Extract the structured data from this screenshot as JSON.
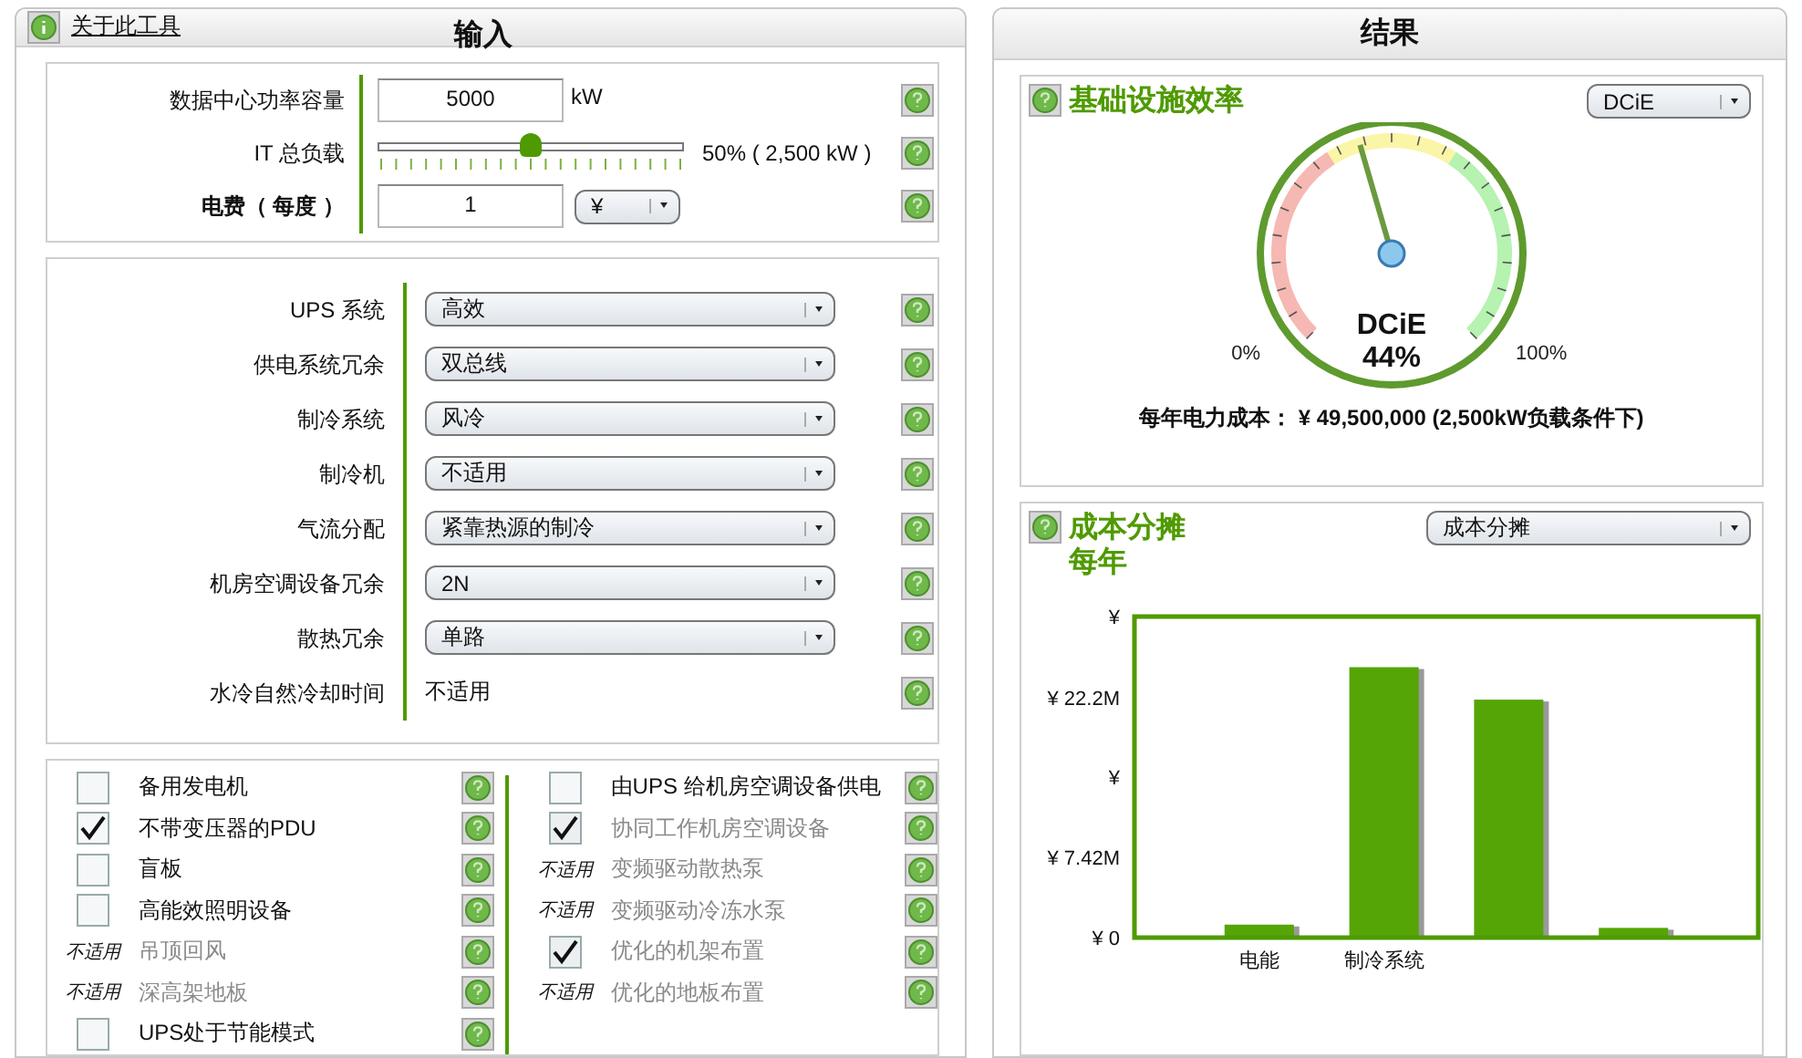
{
  "input_panel": {
    "title": "输入",
    "about_link": "关于此工具",
    "basics": {
      "capacity": {
        "label": "数据中心功率容量",
        "value": "5000",
        "unit": "kW"
      },
      "it_load": {
        "label": "IT 总负载",
        "level": 0.5,
        "reading": "50% ( 2,500 kW )"
      },
      "tariff": {
        "label": "电费（ 每度 ）",
        "value": "1",
        "currency": "¥"
      }
    },
    "systems": [
      {
        "label": "UPS 系统",
        "kind": "dropdown",
        "value": "高效"
      },
      {
        "label": "供电系统冗余",
        "kind": "dropdown",
        "value": "双总线"
      },
      {
        "label": "制冷系统",
        "kind": "dropdown",
        "value": "风冷"
      },
      {
        "label": "制冷机",
        "kind": "dropdown",
        "value": "不适用"
      },
      {
        "label": "气流分配",
        "kind": "dropdown",
        "value": "紧靠热源的制冷"
      },
      {
        "label": "机房空调设备冗余",
        "kind": "dropdown",
        "value": "2N"
      },
      {
        "label": "散热冗余",
        "kind": "dropdown",
        "value": "单路"
      },
      {
        "label": "水冷自然冷却时间",
        "kind": "text",
        "value": "不适用"
      }
    ],
    "options_left": [
      {
        "kind": "checkbox",
        "label": "备用发电机",
        "checked": false,
        "disabled": false
      },
      {
        "kind": "checkbox",
        "label": "不带变压器的PDU",
        "checked": true,
        "disabled": false
      },
      {
        "kind": "checkbox",
        "label": "盲板",
        "checked": false,
        "disabled": false
      },
      {
        "kind": "checkbox",
        "label": "高能效照明设备",
        "checked": false,
        "disabled": false
      },
      {
        "kind": "na",
        "status": "不适用",
        "label": "吊顶回风",
        "disabled": true
      },
      {
        "kind": "na",
        "status": "不适用",
        "label": "深高架地板",
        "disabled": true
      },
      {
        "kind": "checkbox",
        "label": "UPS处于节能模式",
        "checked": false,
        "disabled": false
      }
    ],
    "options_right": [
      {
        "kind": "checkbox",
        "label": "由UPS 给机房空调设备供电",
        "checked": false,
        "disabled": false
      },
      {
        "kind": "checkbox",
        "label": "协同工作机房空调设备",
        "checked": true,
        "disabled": true
      },
      {
        "kind": "na",
        "status": "不适用",
        "label": "变频驱动散热泵",
        "disabled": true
      },
      {
        "kind": "na",
        "status": "不适用",
        "label": "变频驱动冷冻水泵",
        "disabled": true
      },
      {
        "kind": "checkbox",
        "label": "优化的机架布置",
        "checked": true,
        "disabled": true
      },
      {
        "kind": "na",
        "status": "不适用",
        "label": "优化的地板布置",
        "disabled": true
      }
    ]
  },
  "results_panel": {
    "title": "结果",
    "efficiency": {
      "title": "基础设施效率",
      "metric_select": "DCiE",
      "gauge": {
        "label": "DCiE",
        "reading": "44%",
        "level": 0.44,
        "min_label": "0%",
        "max_label": "100%"
      },
      "annual_cost": "每年电力成本： ¥ 49,500,000 (2,500kW负载条件下)"
    },
    "cost": {
      "title": "成本分摊",
      "subtitle": "每年",
      "select": "成本分摊",
      "chart_data": {
        "type": "bar",
        "categories": [
          "电能",
          "制冷系统",
          null,
          null
        ],
        "series": [
          {
            "color": "#55a506",
            "values": [
              1.2,
              25,
              22,
              0.9
            ]
          }
        ],
        "ylim": [
          0,
          29.68
        ],
        "yticks": [
          {
            "value": 0,
            "label": "¥ 0"
          },
          {
            "value": 7.42,
            "label": "¥ 7.42M"
          },
          {
            "value": 14.84,
            "label": "¥"
          },
          {
            "value": 22.2,
            "label": "¥ 22.2M"
          },
          {
            "value": 29.68,
            "label": "¥"
          }
        ]
      }
    }
  }
}
